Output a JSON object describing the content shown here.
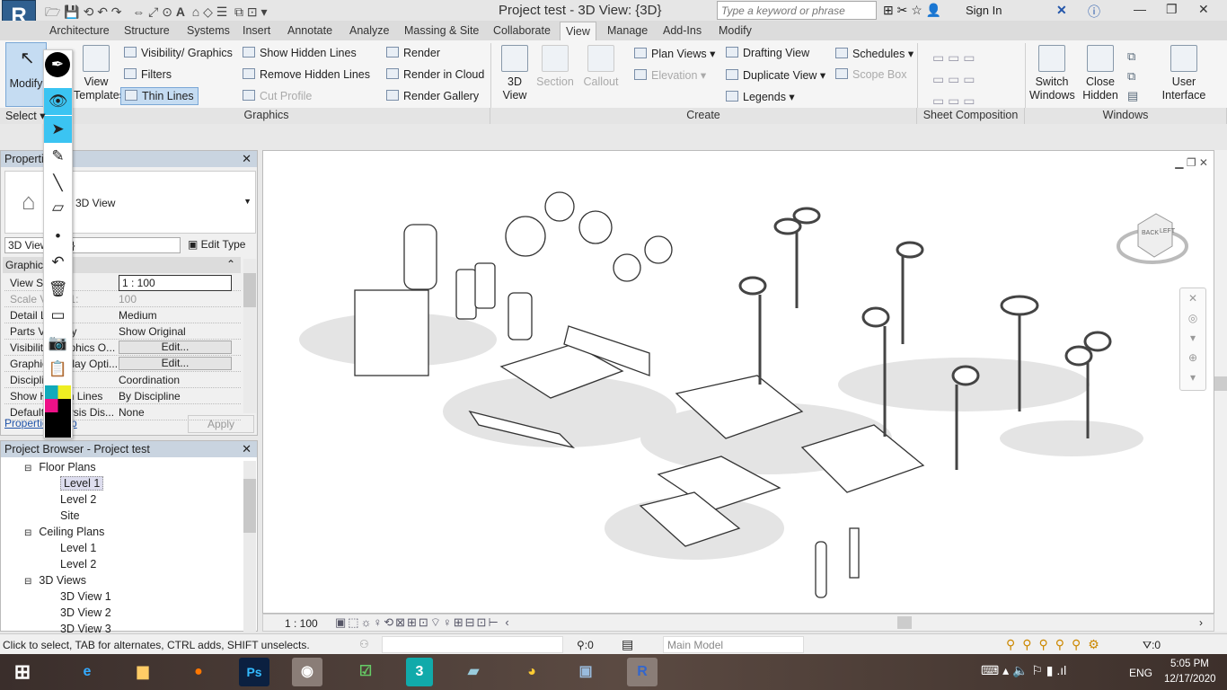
{
  "app": {
    "logo": "R",
    "title": "Project test - 3D View: {3D}",
    "search_placeholder": "Type a keyword or phrase",
    "sign_in": "Sign In"
  },
  "tabs": [
    "Architecture",
    "Structure",
    "Systems",
    "Insert",
    "Annotate",
    "Analyze",
    "Massing & Site",
    "Collaborate",
    "View",
    "Manage",
    "Add-Ins",
    "Modify"
  ],
  "ribbon": {
    "modify": "Modify",
    "select": "Select ▾",
    "view_templates": "View Templates",
    "graphics": [
      "Visibility/ Graphics",
      "Filters",
      "Thin Lines",
      "Show Hidden Lines",
      "Remove Hidden Lines",
      "Cut Profile",
      "Render",
      "Render in Cloud",
      "Render Gallery"
    ],
    "create": [
      "3D View",
      "Section",
      "Callout",
      "Plan Views ▾",
      "Elevation ▾",
      "Drafting View",
      "Duplicate View ▾",
      "Legends ▾",
      "Schedules ▾",
      "Scope Box"
    ],
    "windows": [
      "Switch Windows",
      "Close Hidden",
      "User Interface"
    ],
    "panels": [
      "Graphics",
      "Create",
      "Sheet Composition",
      "Windows"
    ]
  },
  "properties": {
    "title": "Properties",
    "type_name": "3D View",
    "selector": "3D View: {3D}",
    "edit_type": "Edit Type",
    "group": "Graphics",
    "rows": [
      {
        "k": "View Scale",
        "v": "1 : 100"
      },
      {
        "k": "Scale Value 1:",
        "v": "100"
      },
      {
        "k": "Detail Level",
        "v": "Medium"
      },
      {
        "k": "Parts Visibility",
        "v": "Show Original"
      },
      {
        "k": "Visibility/Graphics O...",
        "v": "Edit..."
      },
      {
        "k": "Graphic Display Opti...",
        "v": "Edit..."
      },
      {
        "k": "Discipline",
        "v": "Coordination"
      },
      {
        "k": "Show Hidden Lines",
        "v": "By Discipline"
      },
      {
        "k": "Default Analysis Dis...",
        "v": "None"
      }
    ],
    "help": "Properties help",
    "apply": "Apply"
  },
  "browser": {
    "title": "Project Browser - Project test",
    "items": [
      {
        "t": "Floor Plans",
        "l": 1
      },
      {
        "t": "Level 1",
        "l": 2,
        "sel": true
      },
      {
        "t": "Level 2",
        "l": 2
      },
      {
        "t": "Site",
        "l": 2
      },
      {
        "t": "Ceiling Plans",
        "l": 1
      },
      {
        "t": "Level 1",
        "l": 2
      },
      {
        "t": "Level 2",
        "l": 2
      },
      {
        "t": "3D Views",
        "l": 1
      },
      {
        "t": "3D View 1",
        "l": 2
      },
      {
        "t": "3D View 2",
        "l": 2
      },
      {
        "t": "3D View 3",
        "l": 2
      }
    ]
  },
  "viewcube": {
    "faces": [
      "BACK",
      "LEFT"
    ]
  },
  "viewbar": {
    "scale": "1 : 100"
  },
  "status": {
    "hint": "Click to select, TAB for alternates, CTRL adds, SHIFT unselects.",
    "count": ":0",
    "model": "Main Model",
    "filter": ":0"
  },
  "taskbar": {
    "lang": "ENG",
    "time": "5:05 PM",
    "date": "12/17/2020"
  }
}
